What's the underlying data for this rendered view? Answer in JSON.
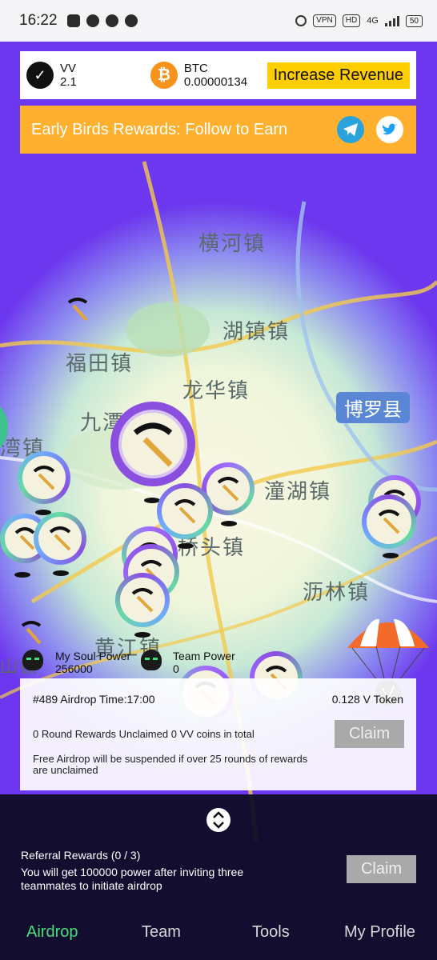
{
  "status_bar": {
    "time": "16:22",
    "icons": [
      "chat-icon",
      "facebook-icon",
      "camera-icon",
      "message-icon"
    ],
    "right_icons": [
      "alarm-icon",
      "vpn-badge",
      "hd-badge",
      "signal-icon"
    ],
    "vpn": "VPN",
    "hd": "HD",
    "network": "4G",
    "battery": "50"
  },
  "coins": {
    "vv": {
      "name": "VV",
      "value": "2.1"
    },
    "btc": {
      "name": "BTC",
      "value": "0.00000134"
    },
    "increase_label": "Increase Revenue"
  },
  "banner": {
    "text": "Early Birds Rewards: Follow to Earn",
    "social_icons": [
      "telegram-icon",
      "twitter-icon"
    ]
  },
  "map": {
    "labels": [
      "横河镇",
      "湖镇镇",
      "福田镇",
      "龙华镇",
      "九潭",
      "湾镇",
      "潼湖镇",
      "桥头镇",
      "沥林镇",
      "黄江镇",
      "山镇"
    ],
    "county": "博罗县"
  },
  "powers": {
    "soul_label": "My Soul Power",
    "soul_value": "256000",
    "team_label": "Team Power",
    "team_value": "0"
  },
  "airdrop": {
    "round": "#489 Airdrop Time:17:00",
    "token": "0.128 V Token",
    "unclaimed": "0 Round Rewards Unclaimed 0 VV coins in total",
    "warning": "Free Airdrop will be suspended if over 25 rounds of rewards are unclaimed",
    "claim_label": "Claim"
  },
  "referral": {
    "title": "Referral Rewards (0 / 3)",
    "desc": "You will get 100000 power after inviting three teammates to initiate airdrop",
    "claim_label": "Claim"
  },
  "nav": {
    "items": [
      "Airdrop",
      "Team",
      "Tools",
      "My Profile"
    ],
    "active": "Airdrop"
  },
  "colors": {
    "background_purple": "#6a37f0",
    "banner_orange": "#ffb02e",
    "button_yellow": "#ffce00",
    "nav_active": "#46e07a"
  }
}
